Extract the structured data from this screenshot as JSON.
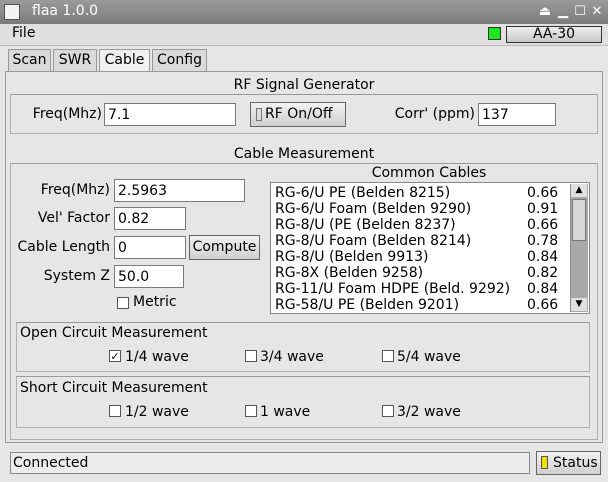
{
  "window": {
    "title": "flaa 1.0.0"
  },
  "menu": {
    "file": "File"
  },
  "device": {
    "name": "AA-30",
    "led_color": "#1ee61e"
  },
  "tabs": [
    {
      "label": "Scan"
    },
    {
      "label": "SWR"
    },
    {
      "label": "Cable",
      "active": true
    },
    {
      "label": "Config"
    }
  ],
  "rf_generator": {
    "title": "RF Signal Generator",
    "freq_label": "Freq(Mhz)",
    "freq_value": "7.1",
    "rf_button": "RF On/Off",
    "corr_label": "Corr' (ppm)",
    "corr_value": "137"
  },
  "cable": {
    "title": "Cable Measurement",
    "freq_label": "Freq(Mhz)",
    "freq_value": "2.5963",
    "vel_label": "Vel' Factor",
    "vel_value": "0.82",
    "length_label": "Cable Length",
    "length_value": "0",
    "compute_button": "Compute",
    "sysz_label": "System Z",
    "sysz_value": "50.0",
    "metric_label": "Metric",
    "metric_checked": false,
    "common_title": "Common Cables",
    "common_cables": [
      {
        "name": "RG-6/U PE (Belden 8215)",
        "vf": "0.66"
      },
      {
        "name": "RG-6/U Foam (Belden 9290)",
        "vf": "0.91"
      },
      {
        "name": "RG-8/U (PE (Belden 8237)",
        "vf": "0.66"
      },
      {
        "name": "RG-8/U Foam (Belden 8214)",
        "vf": "0.78"
      },
      {
        "name": "RG-8/U (Belden 9913)",
        "vf": "0.84"
      },
      {
        "name": "RG-8X (Belden 9258)",
        "vf": "0.82"
      },
      {
        "name": "RG-11/U Foam HDPE (Beld. 9292)",
        "vf": "0.84"
      },
      {
        "name": "RG-58/U PE (Belden 9201)",
        "vf": "0.66"
      }
    ]
  },
  "open_circuit": {
    "title": "Open Circuit Measurement",
    "options": [
      {
        "label": "1/4 wave",
        "checked": true
      },
      {
        "label": "3/4 wave",
        "checked": false
      },
      {
        "label": "5/4 wave",
        "checked": false
      }
    ]
  },
  "short_circuit": {
    "title": "Short Circuit Measurement",
    "options": [
      {
        "label": "1/2 wave",
        "checked": false
      },
      {
        "label": "1 wave",
        "checked": false
      },
      {
        "label": "3/2 wave",
        "checked": false
      }
    ]
  },
  "status": {
    "text": "Connected",
    "button": "Status",
    "led_color": "#f0e000"
  }
}
